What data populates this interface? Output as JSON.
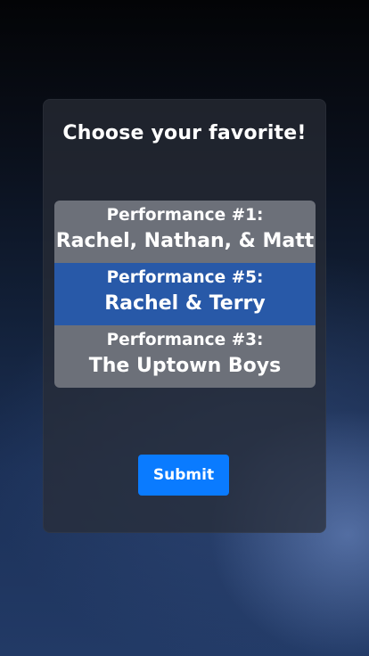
{
  "dialog": {
    "title": "Choose your favorite!"
  },
  "options": [
    {
      "top": "Performance #1:",
      "bottom": "Rachel, Nathan, & Matt",
      "selected": false
    },
    {
      "top": "Performance #5:",
      "bottom": "Rachel & Terry",
      "selected": true
    },
    {
      "top": "Performance #3:",
      "bottom": "The Uptown Boys",
      "selected": false
    }
  ],
  "submit": {
    "label": "Submit"
  },
  "colors": {
    "selected_option": "#2859a8",
    "unselected_option": "#6c7079",
    "submit_button": "#0a7bff"
  }
}
